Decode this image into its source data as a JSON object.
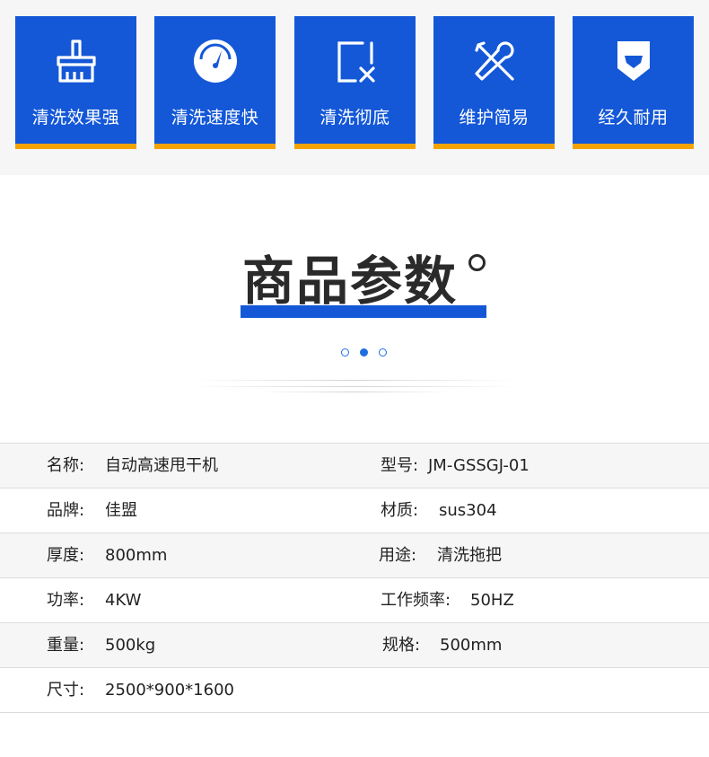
{
  "features": [
    {
      "label": "清洗效果强",
      "icon": "brush-icon"
    },
    {
      "label": "清洗速度快",
      "icon": "speedometer-icon"
    },
    {
      "label": "清洗彻底",
      "icon": "clear-box-icon"
    },
    {
      "label": "维护简易",
      "icon": "tools-icon"
    },
    {
      "label": "经久耐用",
      "icon": "shield-icon"
    }
  ],
  "section": {
    "title": "商品参数"
  },
  "colors": {
    "primary": "#1458d8",
    "accent": "#f4a400"
  },
  "specs": [
    {
      "left_label": "名称:",
      "left_value": "自动高速甩干机",
      "right_label": "型号:",
      "right_value": "JM-GSSGJ-01"
    },
    {
      "left_label": "品牌:",
      "left_value": "佳盟",
      "right_label": "材质:",
      "right_value": "sus304"
    },
    {
      "left_label": "厚度:",
      "left_value": "800mm",
      "right_label": "用途:",
      "right_value": "清洗拖把"
    },
    {
      "left_label": "功率:",
      "left_value": "4KW",
      "right_label": "工作频率:",
      "right_value": "50HZ"
    },
    {
      "left_label": "重量:",
      "left_value": "500kg",
      "right_label": "规格:",
      "right_value": "500mm"
    },
    {
      "left_label": "尺寸:",
      "left_value": "2500*900*1600",
      "right_label": "",
      "right_value": ""
    }
  ]
}
